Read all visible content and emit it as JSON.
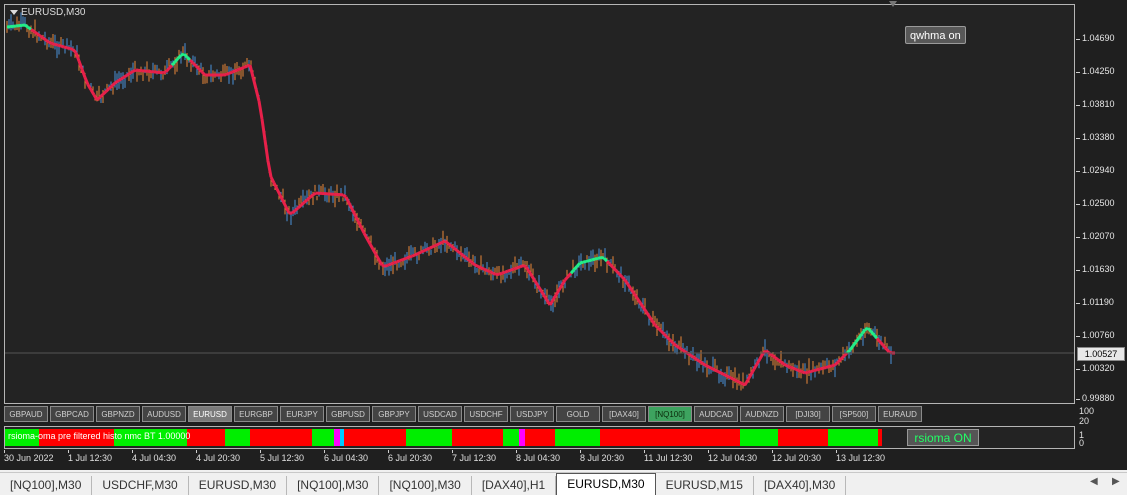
{
  "chart": {
    "title": "EURUSD,M30",
    "qwhma_button": "qwhma on",
    "current_price": "1.00527",
    "price_labels": [
      "1.04690",
      "1.04250",
      "1.03810",
      "1.03380",
      "1.02940",
      "1.02500",
      "1.02070",
      "1.01630",
      "1.01190",
      "1.00760",
      "1.00320",
      "0.99880"
    ]
  },
  "symbols": [
    "GBPAUD",
    "GBPCAD",
    "GBPNZD",
    "AUDUSD",
    "EURUSD",
    "EURGBP",
    "EURJPY",
    "GBPUSD",
    "GBPJPY",
    "USDCAD",
    "USDCHF",
    "USDJPY",
    "GOLD",
    "[DAX40]",
    "[NQ100]",
    "AUDCAD",
    "AUDNZD",
    "[DJI30]",
    "[SP500]",
    "EURAUD"
  ],
  "subwindow": {
    "label": "rsioma-oma pre filtered histo nmc BT 1.00000",
    "button": "rsioma ON",
    "axis_top": "100",
    "axis_20": "20",
    "axis_1": "1",
    "axis_0": "0"
  },
  "time_labels": [
    "30 Jun 2022",
    "1 Jul 12:30",
    "4 Jul 04:30",
    "4 Jul 20:30",
    "5 Jul 12:30",
    "6 Jul 04:30",
    "6 Jul 20:30",
    "7 Jul 12:30",
    "8 Jul 04:30",
    "8 Jul 20:30",
    "11 Jul 12:30",
    "12 Jul 04:30",
    "12 Jul 20:30",
    "13 Jul 12:30"
  ],
  "tabs": [
    "[NQ100],M30",
    "USDCHF,M30",
    "EURUSD,M30",
    "[NQ100],M30",
    "[NQ100],M30",
    "[DAX40],H1",
    "EURUSD,M30",
    "EURUSD,M15",
    "[DAX40],M30"
  ],
  "active_tab_index": 6,
  "colors": {
    "up_bar": "#4a90d9",
    "down_bar": "#e8873a",
    "ma_down": "#e8204a",
    "ma_up": "#22ee88",
    "heat_green": "#00ee00",
    "heat_red": "#ff0000",
    "heat_magenta": "#ff00ff",
    "heat_cyan": "#00ccff"
  },
  "heat_segments": [
    {
      "c": "green",
      "w": 34
    },
    {
      "c": "red",
      "w": 75
    },
    {
      "c": "green",
      "w": 73
    },
    {
      "c": "red",
      "w": 38
    },
    {
      "c": "green",
      "w": 25
    },
    {
      "c": "red",
      "w": 62
    },
    {
      "c": "green",
      "w": 22
    },
    {
      "c": "magenta",
      "w": 6
    },
    {
      "c": "cyan",
      "w": 4
    },
    {
      "c": "red",
      "w": 62
    },
    {
      "c": "green",
      "w": 46
    },
    {
      "c": "red",
      "w": 51
    },
    {
      "c": "green",
      "w": 16
    },
    {
      "c": "magenta",
      "w": 6
    },
    {
      "c": "red",
      "w": 30
    },
    {
      "c": "green",
      "w": 45
    },
    {
      "c": "red",
      "w": 140
    },
    {
      "c": "green",
      "w": 38
    },
    {
      "c": "red",
      "w": 50
    },
    {
      "c": "green",
      "w": 50
    },
    {
      "c": "red",
      "w": 4
    }
  ],
  "arrows": [
    "◀",
    "▶"
  ]
}
